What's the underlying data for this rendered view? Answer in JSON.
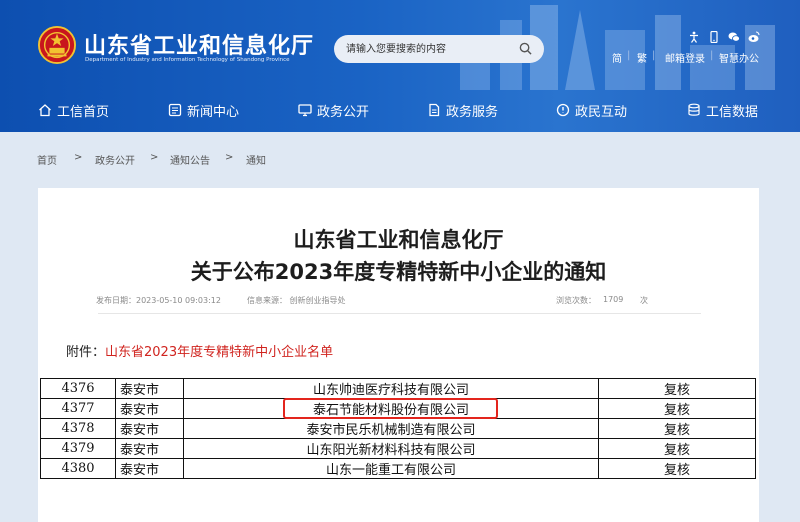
{
  "header": {
    "site_title": "山东省工业和信息化厅",
    "site_subtitle": "Department of Industry and Information Technology of Shandong Province",
    "search_placeholder": "请输入您要搜索的内容",
    "tool_links": [
      "简",
      "繁",
      "邮箱登录",
      "智慧办公"
    ],
    "tool_icons": [
      "accessibility-icon",
      "mobile-icon",
      "wechat-icon",
      "weibo-icon"
    ],
    "colors": {
      "header_bg": "#1a63c4",
      "accent_red": "#d0241f"
    }
  },
  "nav": {
    "items": [
      {
        "label": "工信首页",
        "icon": "home-icon"
      },
      {
        "label": "新闻中心",
        "icon": "news-icon"
      },
      {
        "label": "政务公开",
        "icon": "monitor-icon"
      },
      {
        "label": "政务服务",
        "icon": "document-icon"
      },
      {
        "label": "政民互动",
        "icon": "chat-icon"
      },
      {
        "label": "工信数据",
        "icon": "database-icon"
      }
    ]
  },
  "breadcrumb": {
    "items": [
      "首页",
      "政务公开",
      "通知公告",
      "通知"
    ],
    "separator": ">"
  },
  "article": {
    "title_line1": "山东省工业和信息化厅",
    "title_line2": "关于公布2023年度专精特新中小企业的通知",
    "meta": {
      "publish_date": "发布日期：2023-05-10 09:03:12",
      "source": "信息来源：  创新创业指导处",
      "views_label": "浏览次数：",
      "views": "1709",
      "views_unit": "次"
    },
    "attachment_label": "附件：",
    "attachment_link": "山东省2023年度专精特新中小企业名单"
  },
  "table": {
    "rows": [
      {
        "no": "4376",
        "city": "泰安市",
        "company": "山东帅迪医疗科技有限公司",
        "status": "复核"
      },
      {
        "no": "4377",
        "city": "泰安市",
        "company": "泰石节能材料股份有限公司",
        "status": "复核",
        "highlighted": true
      },
      {
        "no": "4378",
        "city": "泰安市",
        "company": "泰安市民乐机械制造有限公司",
        "status": "复核"
      },
      {
        "no": "4379",
        "city": "泰安市",
        "company": "山东阳光新材料科技有限公司",
        "status": "复核"
      },
      {
        "no": "4380",
        "city": "泰安市",
        "company": "山东一能重工有限公司",
        "status": "复核"
      }
    ]
  }
}
